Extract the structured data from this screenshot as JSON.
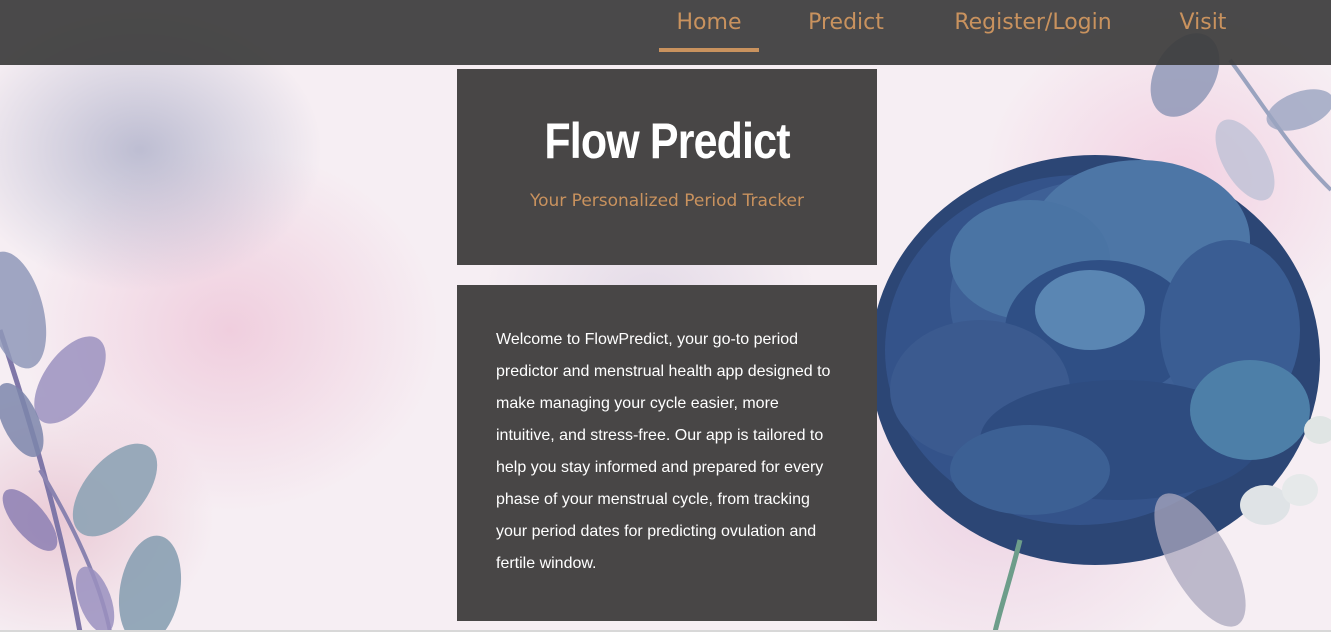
{
  "nav": {
    "items": [
      {
        "label": "Home",
        "active": true
      },
      {
        "label": "Predict",
        "active": false
      },
      {
        "label": "Register/Login",
        "active": false
      },
      {
        "label": "Visit",
        "active": false
      }
    ]
  },
  "hero": {
    "title": "Flow Predict",
    "subtitle": "Your Personalized Period Tracker"
  },
  "description": {
    "text": "Welcome to FlowPredict, your go-to period predictor and menstrual health app designed to make managing your cycle easier, more intuitive, and stress-free. Our app is tailored to help you stay informed and prepared for every phase of your menstrual cycle, from tracking your period dates for predicting ovulation and fertile window."
  },
  "colors": {
    "accent": "#c9925e",
    "panel": "#484646",
    "nav_bg": "#3c3c3c",
    "rose": "#2f4a78"
  },
  "decorations": [
    "watercolor-background",
    "left-leaf-branch",
    "blue-rose-illustration"
  ]
}
